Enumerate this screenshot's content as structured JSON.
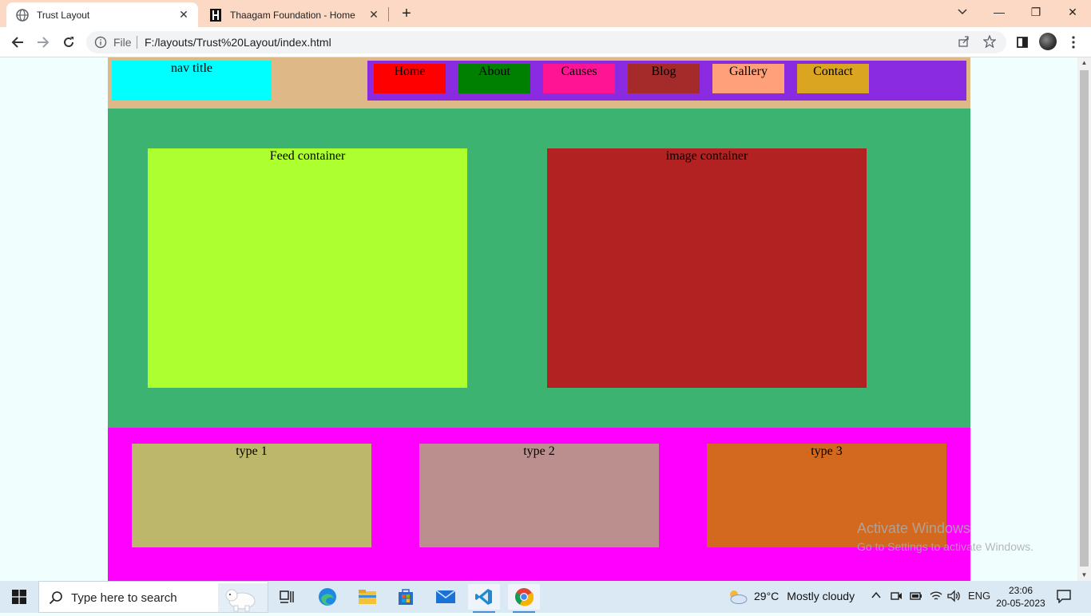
{
  "browser": {
    "tabs": [
      {
        "title": "Trust Layout",
        "close": "✕"
      },
      {
        "title": "Thaagam Foundation - Home",
        "close": "✕"
      }
    ],
    "new_tab": "+",
    "window_controls": {
      "minimize": "—",
      "restore": "❐",
      "close": "✕"
    },
    "address": {
      "scheme_label": "File",
      "url": "F:/layouts/Trust%20Layout/index.html"
    }
  },
  "page": {
    "nav_title": "nav title",
    "nav_items": [
      {
        "label": "Home",
        "color": "#ff0000"
      },
      {
        "label": "About",
        "color": "#008000"
      },
      {
        "label": "Causes",
        "color": "#ff1493"
      },
      {
        "label": "Blog",
        "color": "#a52a2a"
      },
      {
        "label": "Gallery",
        "color": "#ffa07a"
      },
      {
        "label": "Contact",
        "color": "#daa520"
      }
    ],
    "feed_label": "Feed container",
    "image_label": "image container",
    "types": [
      {
        "label": "type 1",
        "color": "#bdb76b"
      },
      {
        "label": "type 2",
        "color": "#bc8f8f"
      },
      {
        "label": "type 3",
        "color": "#d2691e"
      }
    ]
  },
  "watermark": {
    "title": "Activate Windows",
    "subtitle": "Go to Settings to activate Windows."
  },
  "taskbar": {
    "search_placeholder": "Type here to search",
    "weather": {
      "temp": "29°C",
      "condition": "Mostly cloudy"
    },
    "language": "ENG",
    "time": "23:06",
    "date": "20-05-2023"
  },
  "colors": {
    "tabbar": "#fbd9c5",
    "header": "#deb887",
    "nav_box": "#8a2be2",
    "nav_title": "#00ffff",
    "hero": "#3cb371",
    "feed": "#adff2f",
    "image_container": "#b22222",
    "types_section": "#ff00ff"
  }
}
